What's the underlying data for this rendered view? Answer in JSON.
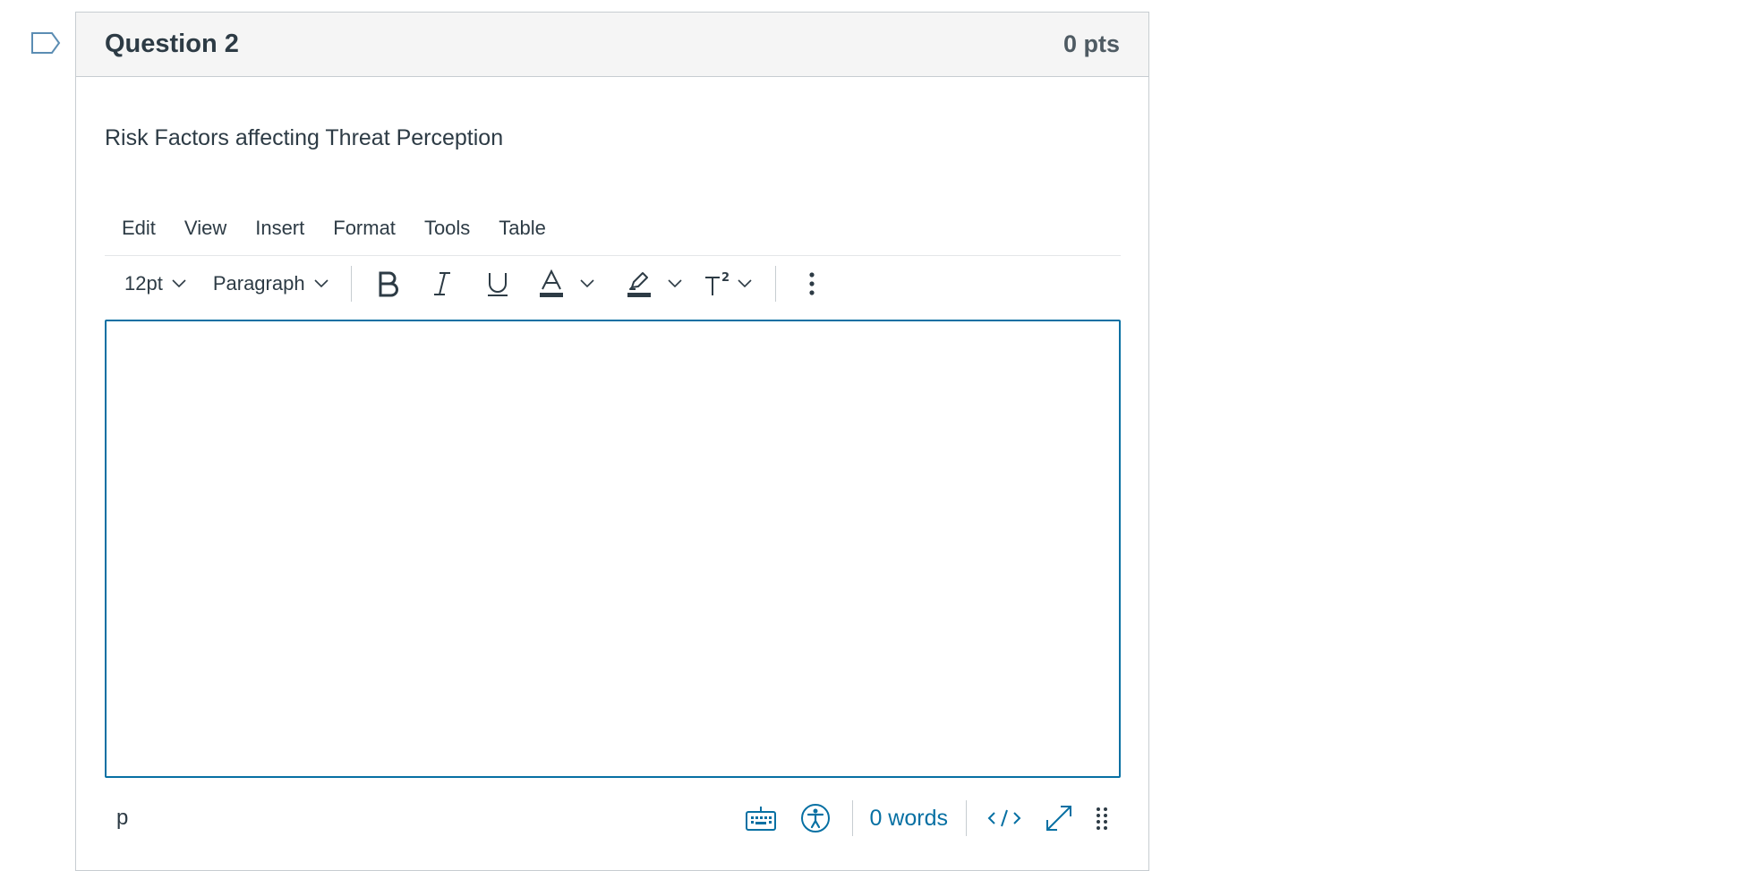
{
  "question": {
    "title": "Question 2",
    "points": "0 pts",
    "text": "Risk Factors affecting Threat Perception",
    "flag_icon": "flag-outline-icon"
  },
  "menubar": {
    "items": [
      "Edit",
      "View",
      "Insert",
      "Format",
      "Tools",
      "Table"
    ]
  },
  "toolbar": {
    "font_size": "12pt",
    "block_format": "Paragraph",
    "icons": [
      "bold-icon",
      "italic-icon",
      "underline-icon",
      "text-color-icon",
      "highlight-color-icon",
      "superscript-icon",
      "more-icon"
    ]
  },
  "editor": {
    "content": ""
  },
  "statusbar": {
    "path": "p",
    "word_count": "0 words",
    "icons": [
      "keyboard-icon",
      "accessibility-icon",
      "html-code-icon",
      "fullscreen-icon",
      "resize-handle-icon"
    ]
  },
  "colors": {
    "accent": "#0770a3",
    "text": "#2d3b45",
    "header_bg": "#f5f5f5",
    "border": "#c7cdd1"
  }
}
